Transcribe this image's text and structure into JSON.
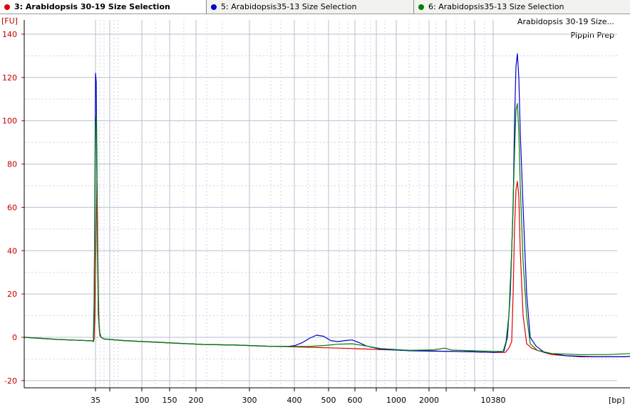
{
  "tabs": [
    {
      "label": "3: Arabidopsis 30-19 Size Selection",
      "color": "#e00000",
      "active": true
    },
    {
      "label": "5: Arabidopsis35-13 Size Selection",
      "color": "#0000d0",
      "active": false
    },
    {
      "label": "6: Arabidopsis35-13  Size Selection",
      "color": "#008000",
      "active": false
    }
  ],
  "chart_data": {
    "type": "line",
    "title": "Arabidopsis 30-19 Size...",
    "subtitle": "Pippin Prep",
    "ylabel": "[FU]",
    "xlabel": "[bp]",
    "ylim": [
      -20,
      140
    ],
    "yticks": [
      -20,
      0,
      20,
      40,
      60,
      80,
      100,
      120,
      140
    ],
    "xticks": [
      "35",
      "100",
      "150",
      "200",
      "300",
      "400",
      "500",
      "600",
      "1000",
      "2000",
      "10380"
    ],
    "grid": true,
    "series": [
      {
        "color": "#e00000",
        "points": [
          [
            0,
            0
          ],
          [
            24,
            -0.5
          ],
          [
            46,
            -1
          ],
          [
            80,
            -1.4
          ],
          [
            95,
            -1.6
          ],
          [
            97,
            -2
          ],
          [
            98,
            -1
          ],
          [
            99,
            10
          ],
          [
            100,
            30
          ],
          [
            101,
            50
          ],
          [
            102,
            72
          ],
          [
            103,
            45
          ],
          [
            104,
            20
          ],
          [
            105,
            5
          ],
          [
            106,
            1
          ],
          [
            108,
            0
          ],
          [
            112,
            -0.8
          ],
          [
            140,
            -1.5
          ],
          [
            200,
            -2.5
          ],
          [
            250,
            -3.3
          ],
          [
            300,
            -3.6
          ],
          [
            340,
            -4.1
          ],
          [
            370,
            -4.3
          ],
          [
            400,
            -4.6
          ],
          [
            440,
            -5
          ],
          [
            470,
            -5.3
          ],
          [
            500,
            -5.7
          ],
          [
            540,
            -6
          ],
          [
            575,
            -6.3
          ],
          [
            600,
            -6.5
          ],
          [
            630,
            -6.7
          ],
          [
            660,
            -7
          ],
          [
            675,
            -7
          ],
          [
            680,
            -5
          ],
          [
            684,
            -2
          ],
          [
            686,
            20
          ],
          [
            688,
            50
          ],
          [
            690,
            68
          ],
          [
            692,
            72
          ],
          [
            694,
            65
          ],
          [
            696,
            40
          ],
          [
            700,
            10
          ],
          [
            705,
            -3
          ],
          [
            712,
            -5
          ],
          [
            720,
            -6
          ],
          [
            740,
            -8
          ],
          [
            780,
            -9
          ],
          [
            810,
            -9
          ],
          [
            840,
            -9
          ],
          [
            864,
            -8.5
          ]
        ]
      },
      {
        "color": "#0000d0",
        "points": [
          [
            0,
            0
          ],
          [
            24,
            -0.5
          ],
          [
            46,
            -1
          ],
          [
            80,
            -1.4
          ],
          [
            95,
            -1.6
          ],
          [
            97,
            -2
          ],
          [
            98,
            15
          ],
          [
            99,
            60
          ],
          [
            100,
            122
          ],
          [
            101,
            118
          ],
          [
            102,
            80
          ],
          [
            103,
            40
          ],
          [
            104,
            10
          ],
          [
            106,
            2
          ],
          [
            108,
            0
          ],
          [
            112,
            -0.8
          ],
          [
            140,
            -1.5
          ],
          [
            200,
            -2.5
          ],
          [
            250,
            -3.3
          ],
          [
            300,
            -3.6
          ],
          [
            340,
            -4.1
          ],
          [
            370,
            -4.2
          ],
          [
            380,
            -3.8
          ],
          [
            390,
            -2.5
          ],
          [
            400,
            -0.5
          ],
          [
            410,
            1
          ],
          [
            420,
            0.5
          ],
          [
            430,
            -1.5
          ],
          [
            440,
            -2
          ],
          [
            450,
            -1.5
          ],
          [
            460,
            -1.2
          ],
          [
            470,
            -2.5
          ],
          [
            480,
            -4
          ],
          [
            500,
            -5.5
          ],
          [
            540,
            -6.2
          ],
          [
            575,
            -6.4
          ],
          [
            600,
            -6.5
          ],
          [
            630,
            -6.7
          ],
          [
            660,
            -7
          ],
          [
            673,
            -6.5
          ],
          [
            678,
            0
          ],
          [
            682,
            20
          ],
          [
            686,
            60
          ],
          [
            688,
            100
          ],
          [
            690,
            125
          ],
          [
            692,
            131
          ],
          [
            694,
            120
          ],
          [
            696,
            95
          ],
          [
            700,
            60
          ],
          [
            705,
            20
          ],
          [
            710,
            0
          ],
          [
            718,
            -4
          ],
          [
            730,
            -7
          ],
          [
            760,
            -8.5
          ],
          [
            800,
            -9
          ],
          [
            840,
            -9
          ],
          [
            850,
            -8.8
          ]
        ]
      },
      {
        "color": "#008000",
        "points": [
          [
            0,
            0
          ],
          [
            24,
            -0.5
          ],
          [
            46,
            -1
          ],
          [
            80,
            -1.4
          ],
          [
            95,
            -1.6
          ],
          [
            97,
            -2
          ],
          [
            98,
            10
          ],
          [
            99,
            50
          ],
          [
            100,
            97
          ],
          [
            101,
            102
          ],
          [
            102,
            70
          ],
          [
            103,
            35
          ],
          [
            104,
            10
          ],
          [
            106,
            2
          ],
          [
            108,
            0
          ],
          [
            112,
            -0.8
          ],
          [
            140,
            -1.5
          ],
          [
            200,
            -2.5
          ],
          [
            250,
            -3.3
          ],
          [
            300,
            -3.6
          ],
          [
            340,
            -4.1
          ],
          [
            370,
            -4.2
          ],
          [
            400,
            -4.2
          ],
          [
            420,
            -3.8
          ],
          [
            440,
            -3.2
          ],
          [
            460,
            -3
          ],
          [
            480,
            -4
          ],
          [
            500,
            -5.2
          ],
          [
            540,
            -6
          ],
          [
            575,
            -5.8
          ],
          [
            590,
            -5
          ],
          [
            600,
            -5.9
          ],
          [
            630,
            -6.2
          ],
          [
            660,
            -6.5
          ],
          [
            672,
            -6.5
          ],
          [
            676,
            -2
          ],
          [
            680,
            10
          ],
          [
            684,
            40
          ],
          [
            688,
            85
          ],
          [
            690,
            105
          ],
          [
            692,
            108
          ],
          [
            694,
            95
          ],
          [
            696,
            70
          ],
          [
            700,
            35
          ],
          [
            705,
            10
          ],
          [
            710,
            -3
          ],
          [
            720,
            -6
          ],
          [
            740,
            -7.5
          ],
          [
            780,
            -8
          ],
          [
            820,
            -8
          ],
          [
            850,
            -7.5
          ],
          [
            864,
            -8
          ]
        ]
      }
    ]
  }
}
